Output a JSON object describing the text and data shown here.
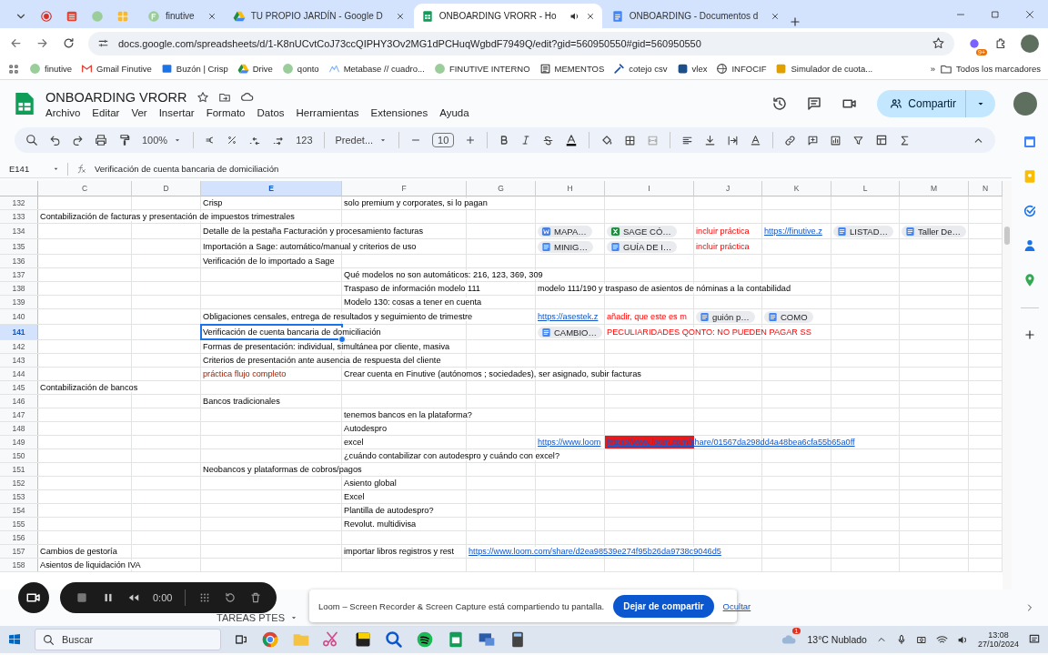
{
  "browser": {
    "tabs": [
      {
        "title": "finutive",
        "selected": false,
        "playing_audio": false
      },
      {
        "title": "TU PROPIO JARDÍN - Google D",
        "selected": false,
        "playing_audio": false
      },
      {
        "title": "ONBOARDING VRORR - Ho",
        "selected": true,
        "playing_audio": true
      },
      {
        "title": "ONBOARDING - Documentos d",
        "selected": false,
        "playing_audio": false
      }
    ],
    "url": "docs.google.com/spreadsheets/d/1-K8nUCvtCoJ73ccQIPHY3Ov2MG1dPCHuqWgbdF7949Q/edit?gid=560950550#gid=560950550",
    "extension_badge": "9+",
    "bookmarks": [
      "finutive",
      "Gmail Finutive",
      "Buzón | Crisp",
      "Drive",
      "qonto",
      "Metabase // cuadro...",
      "FINUTIVE INTERNO",
      "MEMENTOS",
      "cotejo csv",
      "vlex",
      "INFOCIF",
      "Simulador de cuota..."
    ],
    "more_bookmarks": "»",
    "all_bookmarks": "Todos los marcadores"
  },
  "sheet": {
    "title": "ONBOARDING VRORR",
    "menu": [
      "Archivo",
      "Editar",
      "Ver",
      "Insertar",
      "Formato",
      "Datos",
      "Herramientas",
      "Extensiones",
      "Ayuda"
    ],
    "share": "Compartir",
    "toolbar": {
      "zoom": "100%",
      "number_format": "123",
      "font": "Predet...",
      "font_size": "10"
    },
    "name_box": "E141",
    "formula": "Verificación de cuenta bancaria de domiciliación",
    "columns": [
      {
        "label": "C",
        "selected": false
      },
      {
        "label": "D",
        "selected": false
      },
      {
        "label": "E",
        "selected": true
      },
      {
        "label": "F",
        "selected": false
      },
      {
        "label": "G",
        "selected": false
      },
      {
        "label": "H",
        "selected": false
      },
      {
        "label": "I",
        "selected": false
      },
      {
        "label": "J",
        "selected": false
      },
      {
        "label": "K",
        "selected": false
      },
      {
        "label": "L",
        "selected": false
      },
      {
        "label": "M",
        "selected": false
      },
      {
        "label": "N",
        "selected": false
      }
    ],
    "rows": [
      {
        "number": "132",
        "selected": false,
        "cells": [
          "",
          "",
          {
            "kind": "text",
            "text": "Crisp"
          },
          {
            "kind": "text",
            "text": "solo premium y corporates, si lo pagan"
          }
        ]
      },
      {
        "number": "133",
        "selected": false,
        "cells": [
          {
            "kind": "text",
            "text": "Contabilización de facturas y presentación de impuestos trimestrales"
          }
        ]
      },
      {
        "number": "134",
        "selected": false,
        "cells": [
          "",
          "",
          {
            "kind": "text",
            "text": "Detalle de la pestaña Facturación y procesamiento facturas"
          },
          "",
          "",
          {
            "kind": "word",
            "text": "MAPA…"
          },
          {
            "kind": "excel",
            "text": "SAGE CÓ…"
          },
          {
            "kind": "alert",
            "text": "incluir práctica"
          },
          {
            "kind": "link",
            "text": "https://finutive.z"
          },
          {
            "kind": "doc",
            "text": "LISTAD…"
          },
          {
            "kind": "doc",
            "text": "Taller De…"
          }
        ]
      },
      {
        "number": "135",
        "selected": false,
        "cells": [
          "",
          "",
          {
            "kind": "text",
            "text": "Importación a Sage: automático/manual y criterios de uso"
          },
          "",
          "",
          {
            "kind": "doc",
            "text": "MINIG…"
          },
          {
            "kind": "doc",
            "text": "GUÍA DE I…"
          },
          {
            "kind": "alert",
            "text": "incluir práctica"
          }
        ]
      },
      {
        "number": "136",
        "selected": false,
        "cells": [
          "",
          "",
          {
            "kind": "text",
            "text": "Verificación de lo importado a Sage"
          }
        ]
      },
      {
        "number": "137",
        "selected": false,
        "cells": [
          "",
          "",
          "",
          {
            "kind": "text",
            "text": "Qué modelos no son automáticos: 216, 123, 369, 309"
          }
        ]
      },
      {
        "number": "138",
        "selected": false,
        "cells": [
          "",
          "",
          "",
          {
            "kind": "text",
            "text": "Traspaso de información modelo 111"
          },
          "",
          {
            "kind": "text",
            "text": "modelo 111/190 y traspaso de asientos de nóminas a la contabilidad"
          }
        ]
      },
      {
        "number": "139",
        "selected": false,
        "cells": [
          "",
          "",
          "",
          {
            "kind": "text",
            "text": "Modelo 130: cosas a tener en cuenta"
          }
        ]
      },
      {
        "number": "140",
        "selected": false,
        "cells": [
          "",
          "",
          {
            "kind": "text",
            "text": "Obligaciones censales, entrega de resultados  y seguimiento de trimestre"
          },
          "",
          "",
          {
            "kind": "link",
            "text": "https://asestek.z"
          },
          {
            "kind": "alert",
            "text": "añadir, que este es m"
          },
          {
            "kind": "doc",
            "text": "guión p…"
          },
          {
            "kind": "doc",
            "text": "COMO"
          }
        ]
      },
      {
        "number": "141",
        "selected": true,
        "cells": [
          "",
          "",
          {
            "kind": "text",
            "text": "Verificación de cuenta bancaria de domiciliación"
          },
          "",
          "",
          {
            "kind": "doc",
            "text": "CAMBIO…"
          },
          {
            "kind": "alert",
            "text": "PECULIARIDADES QONTO: NO PUEDEN PAGAR SS"
          }
        ]
      },
      {
        "number": "142",
        "selected": false,
        "cells": [
          "",
          "",
          {
            "kind": "text",
            "text": "Formas de presentación: individual, simultánea por cliente, masiva"
          }
        ]
      },
      {
        "number": "143",
        "selected": false,
        "cells": [
          "",
          "",
          {
            "kind": "text",
            "text": "Criterios de presentación ante ausencia de respuesta del cliente"
          }
        ]
      },
      {
        "number": "144",
        "selected": false,
        "cells": [
          "",
          "",
          {
            "kind": "remark",
            "text": "práctica flujo completo"
          },
          {
            "kind": "text",
            "text": "Crear cuenta en Finutive (autónomos ; sociedades), ser asignado, subir facturas"
          }
        ]
      },
      {
        "number": "145",
        "selected": false,
        "cells": [
          {
            "kind": "text",
            "text": "Contabilización de bancos"
          }
        ]
      },
      {
        "number": "146",
        "selected": false,
        "cells": [
          "",
          "",
          {
            "kind": "text",
            "text": "Bancos tradicionales"
          }
        ]
      },
      {
        "number": "147",
        "selected": false,
        "cells": [
          "",
          "",
          "",
          {
            "kind": "text",
            "text": "tenemos bancos en la plataforma?"
          }
        ]
      },
      {
        "number": "148",
        "selected": false,
        "cells": [
          "",
          "",
          "",
          {
            "kind": "text",
            "text": "Autodespro"
          }
        ]
      },
      {
        "number": "149",
        "selected": false,
        "cells": [
          "",
          "",
          "",
          {
            "kind": "text",
            "text": "excel"
          },
          "",
          {
            "kind": "link",
            "text": "https://www.loom"
          },
          {
            "kind": "link",
            "highlight": true,
            "text": "https://www.loom.com/share/01567da298dd4a48bea6cfa55b65a0ff"
          }
        ]
      },
      {
        "number": "150",
        "selected": false,
        "cells": [
          "",
          "",
          "",
          {
            "kind": "text",
            "text": "¿cuándo contabilizar con autodespro y cuándo con excel?"
          }
        ]
      },
      {
        "number": "151",
        "selected": false,
        "cells": [
          "",
          "",
          {
            "kind": "text",
            "text": "Neobancos y plataformas de cobros/pagos"
          }
        ]
      },
      {
        "number": "152",
        "selected": false,
        "cells": [
          "",
          "",
          "",
          {
            "kind": "text",
            "text": "Asiento global"
          }
        ]
      },
      {
        "number": "153",
        "selected": false,
        "cells": [
          "",
          "",
          "",
          {
            "kind": "text",
            "text": "Excel"
          }
        ]
      },
      {
        "number": "154",
        "selected": false,
        "cells": [
          "",
          "",
          "",
          {
            "kind": "text",
            "text": "Plantilla de autodespro?"
          }
        ]
      },
      {
        "number": "155",
        "selected": false,
        "cells": [
          "",
          "",
          "",
          {
            "kind": "text",
            "text": "Revolut. multidivisa"
          }
        ]
      },
      {
        "number": "156",
        "selected": false
      },
      {
        "number": "157",
        "selected": false,
        "cells": [
          {
            "kind": "text",
            "text": "Cambios de gestoría"
          },
          "",
          "",
          {
            "kind": "text",
            "text": "importar libros registros y rest"
          },
          {
            "kind": "link",
            "text": "https://www.loom.com/share/d2ea98539e274f95b26da9738c9046d5"
          }
        ]
      },
      {
        "number": "158",
        "selected": false,
        "cells": [
          {
            "kind": "text",
            "text": "Asientos de liquidación IVA"
          }
        ]
      }
    ],
    "sheet_tabs": [
      {
        "label": "TAREAS PTES",
        "selected": false
      }
    ]
  },
  "recorder": {
    "time": "0:00"
  },
  "share_notice": {
    "message": "Loom – Screen Recorder & Screen Capture está compartiendo tu pantalla.",
    "stop_button": "Dejar de compartir",
    "hide_link": "Ocultar"
  },
  "taskbar": {
    "search_placeholder": "Buscar",
    "weather": "13°C Nublado",
    "weather_badge": "1",
    "time": "13:08",
    "date": "27/10/2024"
  }
}
